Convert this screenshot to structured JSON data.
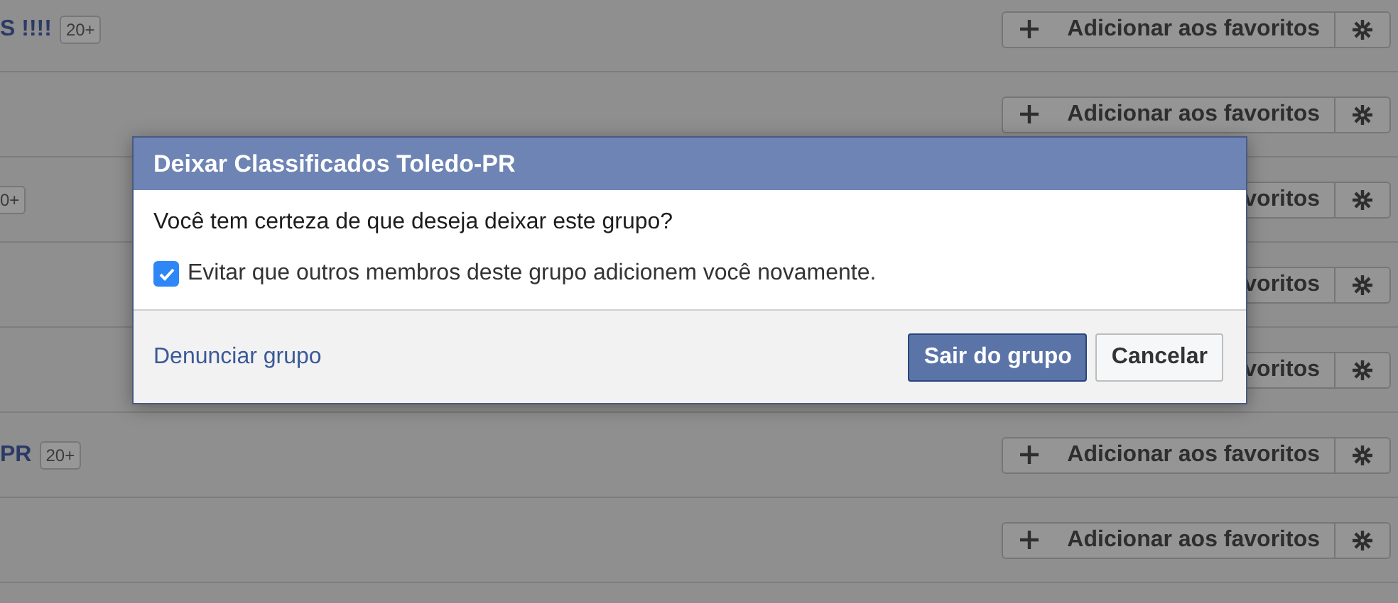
{
  "groups": [
    {
      "name": "S !!!!",
      "badge": "20+",
      "favorite_button": "Adicionar aos favoritos"
    },
    {
      "favorite_button": "Adicionar aos favoritos"
    },
    {
      "badge": "0+",
      "favorite_button": "voritos"
    },
    {
      "favorite_button": "voritos"
    },
    {
      "favorite_button": "voritos"
    },
    {
      "name": "PR",
      "badge": "20+",
      "favorite_button": "Adicionar aos favoritos"
    },
    {
      "favorite_button": "Adicionar aos favoritos"
    }
  ],
  "dialog": {
    "title": "Deixar Classificados Toledo-PR",
    "question": "Você tem certeza de que deseja deixar este grupo?",
    "option": {
      "label": "Evitar que outros membros deste grupo adicionem você novamente.",
      "checked": true
    },
    "report_link": "Denunciar grupo",
    "buttons": [
      {
        "label": "Sair do grupo",
        "kind": "primary"
      },
      {
        "label": "Cancelar",
        "kind": "secondary"
      }
    ]
  }
}
